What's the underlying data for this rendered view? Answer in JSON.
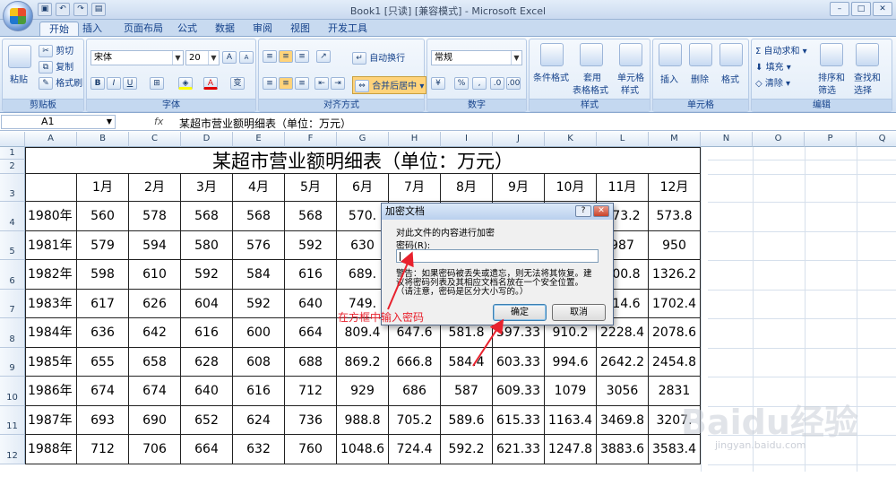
{
  "window": {
    "title": "Book1 [只读] [兼容模式] - Microsoft Excel"
  },
  "tabs": [
    "开始",
    "插入",
    "页面布局",
    "公式",
    "数据",
    "审阅",
    "视图",
    "开发工具"
  ],
  "ribbon": {
    "clipboard": {
      "label": "剪贴板",
      "paste": "粘贴",
      "cut": "剪切",
      "copy": "复制",
      "format_painter": "格式刷"
    },
    "font": {
      "label": "字体",
      "name": "宋体",
      "size": "20",
      "grow": "A",
      "shrink": "A",
      "bold": "B",
      "italic": "I",
      "underline": "U",
      "color": "A",
      "wen": "变"
    },
    "alignment": {
      "label": "对齐方式",
      "wrap": "自动换行",
      "merge": "合并后居中"
    },
    "number": {
      "label": "数字",
      "format": "常规",
      "percent": "%",
      "comma": ","
    },
    "styles": {
      "label": "样式",
      "cond": "条件格式",
      "table1": "套用",
      "table2": "表格格式",
      "cell1": "单元格",
      "cell2": "样式"
    },
    "cells": {
      "label": "单元格",
      "insert": "插入",
      "delete": "删除",
      "format": "格式"
    },
    "editing": {
      "label": "编辑",
      "autosum": "自动求和",
      "fill": "填充",
      "clear": "清除",
      "sort1": "排序和",
      "sort2": "筛选",
      "find1": "查找和",
      "find2": "选择"
    }
  },
  "formula_bar": {
    "name_box": "A1",
    "fx": "fx",
    "content": "某超市营业额明细表（单位：万元）"
  },
  "columns": [
    "A",
    "B",
    "C",
    "D",
    "E",
    "F",
    "G",
    "H",
    "I",
    "J",
    "K",
    "L",
    "M",
    "N",
    "O",
    "P",
    "Q"
  ],
  "rows": [
    "1",
    "2",
    "3",
    "4",
    "5",
    "6",
    "7",
    "8",
    "9",
    "10",
    "11",
    "12"
  ],
  "table": {
    "title": "某超市营业额明细表（单位：万元）",
    "header": [
      "1月",
      "2月",
      "3月",
      "4月",
      "5月",
      "6月",
      "7月",
      "8月",
      "9月",
      "10月",
      "11月",
      "12月"
    ],
    "rows": [
      {
        "year": "1980年",
        "values": [
          "560",
          "578",
          "568",
          "568",
          "568",
          "570.",
          "",
          "",
          "",
          "",
          "573.2",
          "573.8"
        ]
      },
      {
        "year": "1981年",
        "values": [
          "579",
          "594",
          "580",
          "576",
          "592",
          "630",
          "",
          "",
          "",
          "",
          "987",
          "950"
        ]
      },
      {
        "year": "1982年",
        "values": [
          "598",
          "610",
          "592",
          "584",
          "616",
          "689.",
          "",
          "",
          "",
          "",
          "400.8",
          "1326.2"
        ]
      },
      {
        "year": "1983年",
        "values": [
          "617",
          "626",
          "604",
          "592",
          "640",
          "749.",
          "",
          "",
          "",
          "",
          "814.6",
          "1702.4"
        ]
      },
      {
        "year": "1984年",
        "values": [
          "636",
          "642",
          "616",
          "600",
          "664",
          "809.4",
          "647.6",
          "581.8",
          "597.33",
          "910.2",
          "2228.4",
          "2078.6"
        ]
      },
      {
        "year": "1985年",
        "values": [
          "655",
          "658",
          "628",
          "608",
          "688",
          "869.2",
          "666.8",
          "584.4",
          "603.33",
          "994.6",
          "2642.2",
          "2454.8"
        ]
      },
      {
        "year": "1986年",
        "values": [
          "674",
          "674",
          "640",
          "616",
          "712",
          "929",
          "686",
          "587",
          "609.33",
          "1079",
          "3056",
          "2831"
        ]
      },
      {
        "year": "1987年",
        "values": [
          "693",
          "690",
          "652",
          "624",
          "736",
          "988.8",
          "705.2",
          "589.6",
          "615.33",
          "1163.4",
          "3469.8",
          "3207."
        ]
      },
      {
        "year": "1988年",
        "values": [
          "712",
          "706",
          "664",
          "632",
          "760",
          "1048.6",
          "724.4",
          "592.2",
          "621.33",
          "1247.8",
          "3883.6",
          "3583.4"
        ]
      }
    ]
  },
  "dialog": {
    "title": "加密文档",
    "help": "?",
    "close": "✕",
    "desc": "对此文件的内容进行加密",
    "pwd_label": "密码(R):",
    "warn1": "警告：如果密码被丢失或遗忘，则无法将其恢复。建",
    "warn2": "议将密码列表及其相应文档名放在一个安全位置。",
    "warn3": "（请注意，密码是区分大小写的。）",
    "ok": "确定",
    "cancel": "取消"
  },
  "annotation": "在方框中输入密码",
  "watermark": {
    "main": "Baidu经验",
    "sub": "jingyan.baidu.com"
  }
}
